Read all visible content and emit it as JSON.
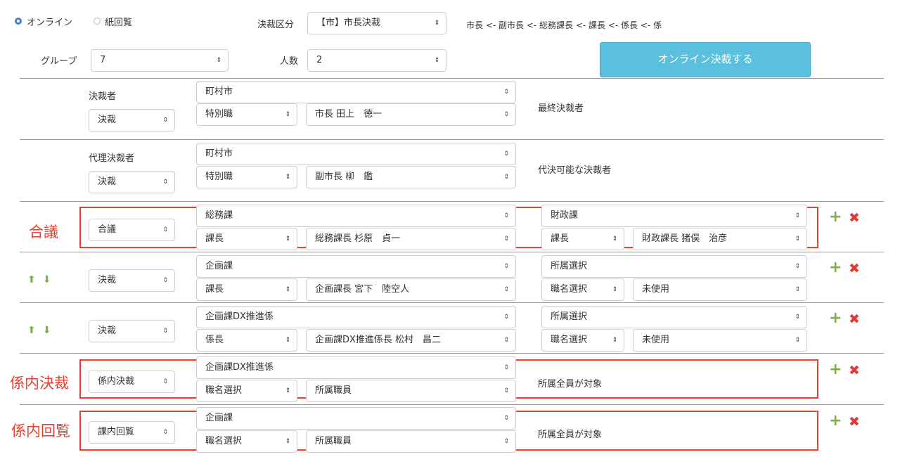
{
  "top": {
    "radio_online": "オンライン",
    "radio_paper": "紙回覧",
    "kessai_kubun_label": "決裁区分",
    "kessai_kubun_value": "【市】市長決裁",
    "route_text": "市長 <- 副市長 <- 総務課長 <- 課長 <- 係長 <- 係",
    "group_label": "グループ",
    "group_value": "7",
    "ninzu_label": "人数",
    "ninzu_value": "2",
    "submit_button": "オンライン決裁する"
  },
  "rows": {
    "r1": {
      "role_label": "決裁者",
      "type": "決裁",
      "dept": "町村市",
      "title": "特別職",
      "person": "市長 田上　徳一",
      "note": "最終決裁者"
    },
    "r2": {
      "role_label": "代理決裁者",
      "type": "決裁",
      "dept": "町村市",
      "title": "特別職",
      "person": "副市長 柳　鑑",
      "note": "代決可能な決裁者"
    },
    "r3": {
      "side_label": "合議",
      "type": "合議",
      "dept": "総務課",
      "title": "課長",
      "person": "総務課長 杉原　貞一",
      "dept2": "財政課",
      "title2": "課長",
      "person2": "財政課長 猪俣　治彦"
    },
    "r4": {
      "type": "決裁",
      "dept": "企画課",
      "title": "課長",
      "person": "企画課長 宮下　陸空人",
      "dept2": "所属選択",
      "title2": "職名選択",
      "person2": "未使用"
    },
    "r5": {
      "type": "決裁",
      "dept": "企画課DX推進係",
      "title": "係長",
      "person": "企画課DX推進係長 松村　昌二",
      "dept2": "所属選択",
      "title2": "職名選択",
      "person2": "未使用"
    },
    "r6": {
      "side_label": "係内決裁",
      "type": "係内決裁",
      "dept": "企画課DX推進係",
      "title": "職名選択",
      "person": "所属職員",
      "note": "所属全員が対象"
    },
    "r7": {
      "side_label": "係内回覧",
      "type": "課内回覧",
      "dept": "企画課",
      "title": "職名選択",
      "person": "所属職員",
      "note": "所属全員が対象"
    }
  },
  "icons": {
    "updown_arrow": "⇕",
    "add": "+",
    "remove": "✖",
    "up": "⬆",
    "down": "⬇"
  },
  "colors": {
    "primary_button": "#5bc0de",
    "highlight_red": "#e8402f",
    "add_green": "#7cb342",
    "remove_red": "#e53935",
    "radio_blue": "#3e86c6"
  }
}
